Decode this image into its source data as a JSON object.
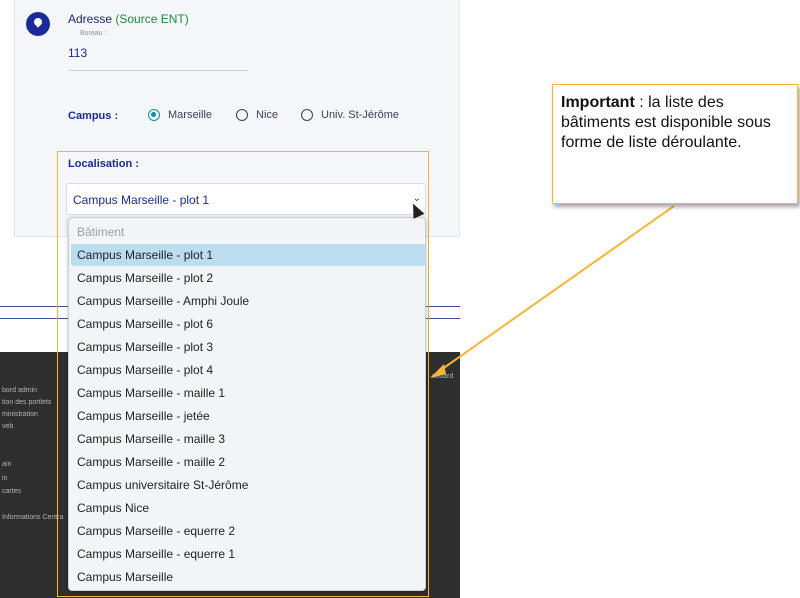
{
  "address": {
    "label": "Adresse",
    "source": "(Source ENT)",
    "sublabel": "Bureau :",
    "value": "113"
  },
  "campus": {
    "label": "Campus :",
    "options": [
      "Marseille",
      "Nice",
      "Univ. St-Jérôme"
    ],
    "selected": "Marseille"
  },
  "localisation": {
    "label": "Localisation :",
    "selected_value": "Campus Marseille - plot 1",
    "placeholder": "Bâtiment",
    "options": [
      "Campus Marseille - plot 1",
      "Campus Marseille - plot 2",
      "Campus Marseille - Amphi Joule",
      "Campus Marseille - plot 6",
      "Campus Marseille - plot 3",
      "Campus Marseille - plot 4",
      "Campus Marseille - maille 1",
      "Campus Marseille - jetée",
      "Campus Marseille - maille 3",
      "Campus Marseille - maille 2",
      "Campus universitaire St-Jérôme",
      "Campus Nice",
      "Campus Marseille - equerre 2",
      "Campus Marseille - equerre 1",
      "Campus Marseille"
    ]
  },
  "footer": {
    "links": [
      "bord admin",
      "tion des portlets",
      "ministration",
      "veb",
      "ain",
      "in",
      "cartes",
      "Informations Centra"
    ],
    "right_link": "sboard"
  },
  "callout": {
    "bold": "Important",
    "text": " : la liste des bâtiments est disponible sous forme de liste déroulante."
  },
  "colors": {
    "accent": "#f4b53a",
    "navy": "#1a2a9a",
    "selected_row": "#bcdcf0",
    "radio": "#0e8fa8"
  }
}
